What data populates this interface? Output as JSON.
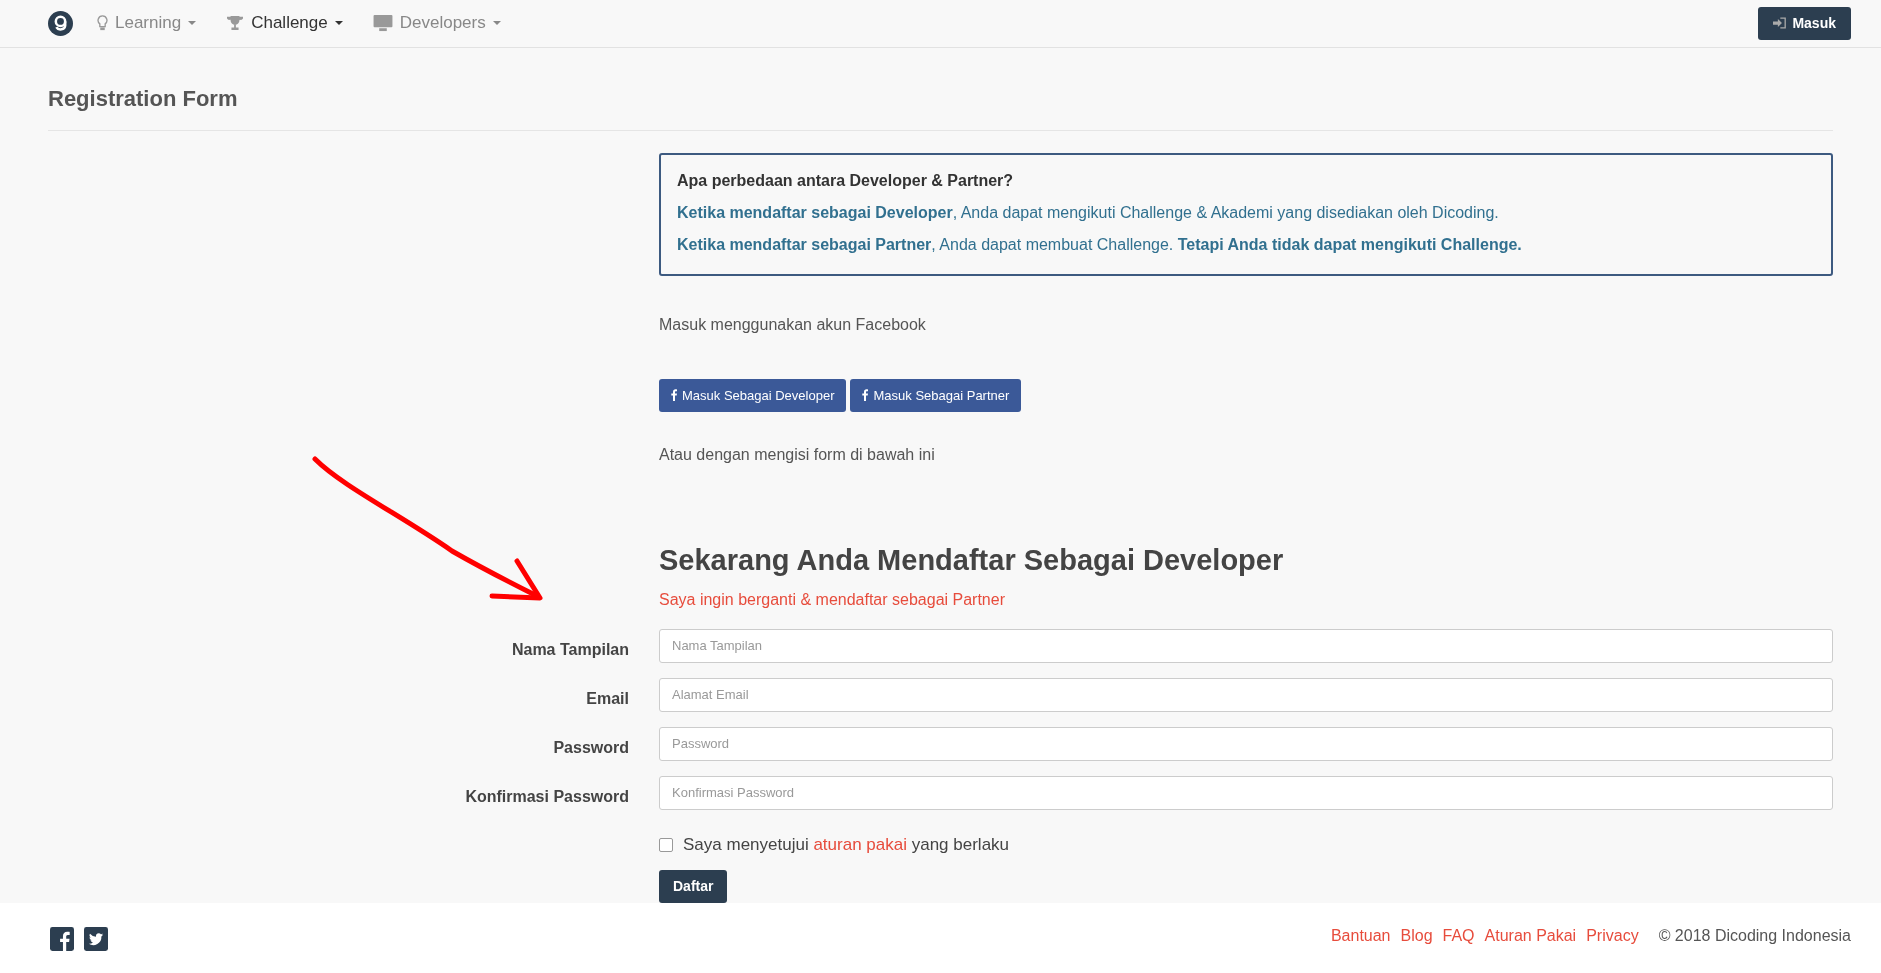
{
  "navbar": {
    "items": [
      {
        "label": "Learning",
        "kind": "bulb",
        "selected": false
      },
      {
        "label": "Challenge",
        "kind": "trophy",
        "selected": true
      },
      {
        "label": "Developers",
        "kind": "monitor",
        "selected": false
      }
    ],
    "login_button": "Masuk"
  },
  "page_title": "Registration Form",
  "info_box": {
    "question": "Apa perbedaan antara Developer & Partner?",
    "lines": [
      "**Ketika mendaftar sebagai Developer**, Anda dapat mengikuti Challenge & Akademi yang disediakan oleh Dicoding.",
      "**Ketika mendaftar sebagai Partner**, Anda dapat membuat Challenge. **Tetapi Anda tidak dapat mengikuti Challenge.**"
    ]
  },
  "facebook_prompt": "Masuk menggunakan akun Facebook",
  "facebook_buttons": [
    "Masuk Sebagai Developer",
    "Masuk Sebagai Partner"
  ],
  "form_prompt": "Atau dengan mengisi form di bawah ini",
  "form": {
    "heading": "Sekarang Anda Mendaftar Sebagai Developer",
    "switch_link": "Saya ingin berganti & mendaftar sebagai Partner",
    "fields": [
      {
        "label": "Nama Tampilan",
        "placeholder": "Nama Tampilan"
      },
      {
        "label": "Email",
        "placeholder": "Alamat Email"
      },
      {
        "label": "Password",
        "placeholder": "Password"
      },
      {
        "label": "Konfirmasi Password",
        "placeholder": "Konfirmasi Password"
      }
    ],
    "terms": {
      "checked": false,
      "before": "Saya menyetujui",
      "link": "aturan pakai",
      "after": "yang berlaku"
    },
    "submit": "Daftar"
  },
  "footer": {
    "links": [
      "Bantuan",
      "Blog",
      "FAQ",
      "Aturan Pakai",
      "Privacy"
    ],
    "copyright": "© 2018 Dicoding Indonesia"
  }
}
